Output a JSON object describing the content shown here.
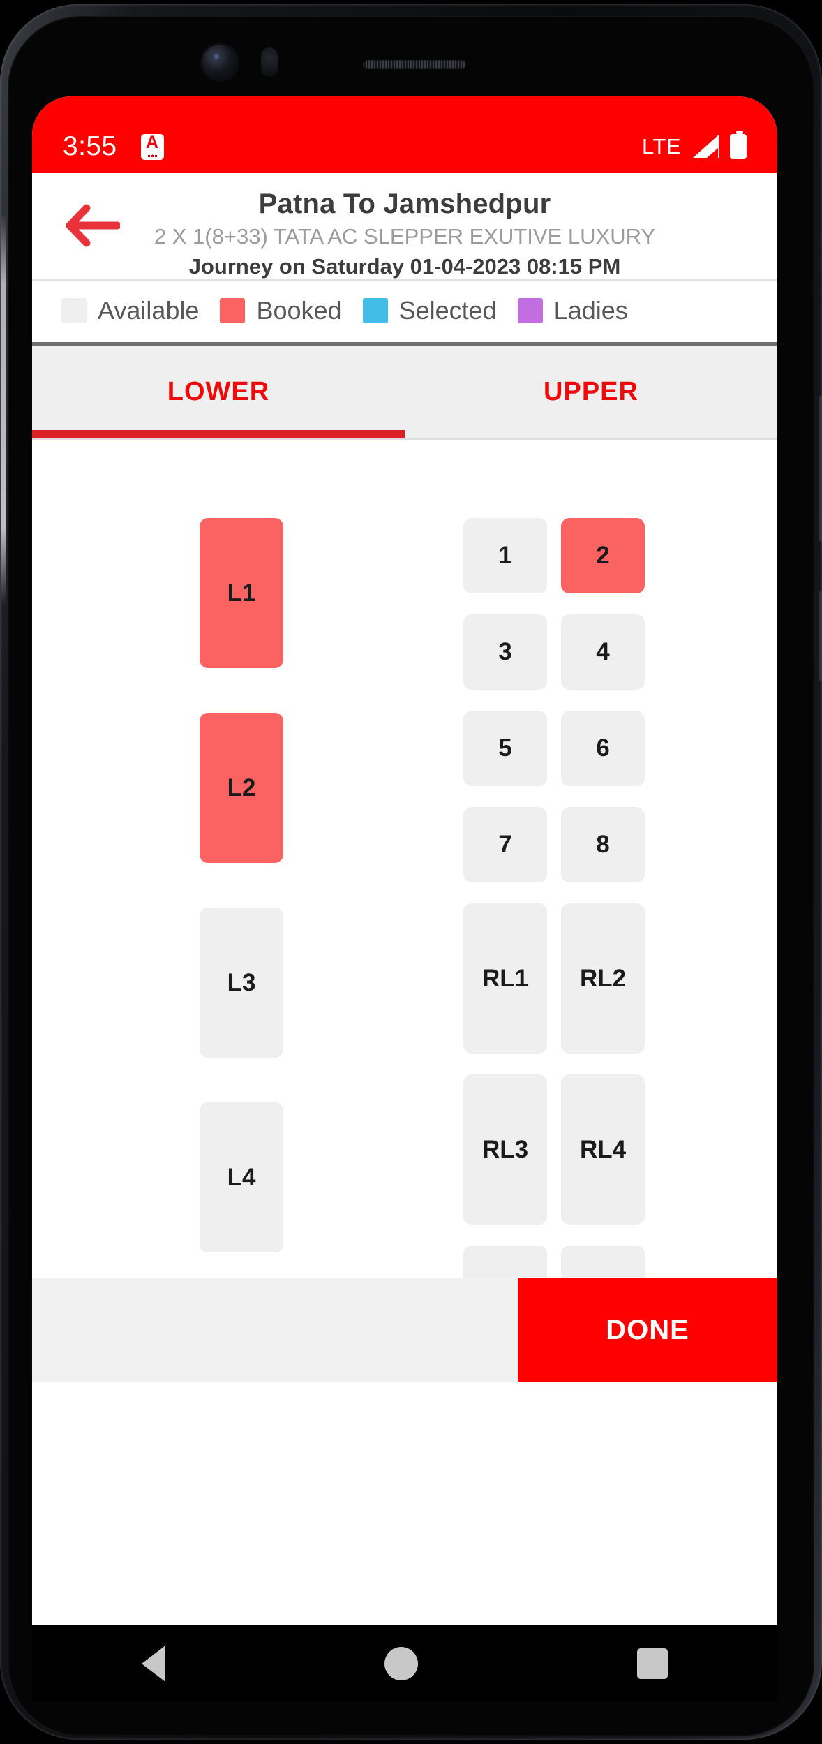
{
  "statusbar": {
    "time": "3:55",
    "app_icon": "A",
    "network": "LTE",
    "signal_icon": "signal-bars-icon",
    "battery_icon": "battery-full-icon"
  },
  "header": {
    "back_icon": "back-arrow-icon",
    "title": "Patna To Jamshedpur",
    "bus_details": "2 X 1(8+33) TATA AC SLEPPER EXUTIVE LUXURY",
    "journey": "Journey on Saturday 01-04-2023  08:15 PM"
  },
  "legend": {
    "items": [
      {
        "label": "Available",
        "color": "#efefef"
      },
      {
        "label": "Booked",
        "color": "#fb6363"
      },
      {
        "label": "Selected",
        "color": "#41bde8"
      },
      {
        "label": "Ladies",
        "color": "#c06ee0"
      }
    ]
  },
  "tabs": {
    "active": "LOWER",
    "items": [
      {
        "label": "LOWER",
        "active": true
      },
      {
        "label": "UPPER",
        "active": false
      }
    ]
  },
  "deck": {
    "sleepers": [
      {
        "label": "L1",
        "status": "booked"
      },
      {
        "label": "L2",
        "status": "booked"
      },
      {
        "label": "L3",
        "status": "available"
      },
      {
        "label": "L4",
        "status": "available"
      }
    ],
    "seat_pairs": [
      [
        {
          "label": "1",
          "status": "available"
        },
        {
          "label": "2",
          "status": "booked"
        }
      ],
      [
        {
          "label": "3",
          "status": "available"
        },
        {
          "label": "4",
          "status": "available"
        }
      ],
      [
        {
          "label": "5",
          "status": "available"
        },
        {
          "label": "6",
          "status": "available"
        }
      ],
      [
        {
          "label": "7",
          "status": "available"
        },
        {
          "label": "8",
          "status": "available"
        }
      ]
    ],
    "rear_sleepers": [
      [
        {
          "label": "RL1",
          "status": "available"
        },
        {
          "label": "RL2",
          "status": "available"
        }
      ],
      [
        {
          "label": "RL3",
          "status": "available"
        },
        {
          "label": "RL4",
          "status": "available"
        }
      ]
    ]
  },
  "bottom": {
    "done_label": "DONE"
  },
  "navbar": {
    "back_icon": "nav-back-triangle-icon",
    "home_icon": "nav-home-circle-icon",
    "recent_icon": "nav-recents-square-icon"
  },
  "colors": {
    "brand_red": "#fe0000",
    "tab_red": "#f00b0b",
    "indicator_red": "#dd1f26",
    "booked": "#fb6363",
    "available": "#efefef",
    "selected": "#41bde8",
    "ladies": "#c06ee0"
  }
}
